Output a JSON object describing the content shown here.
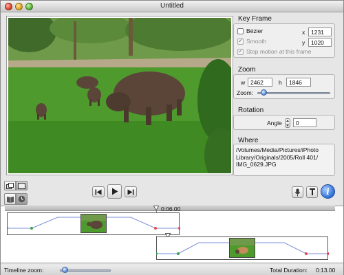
{
  "window": {
    "title": "Untitled"
  },
  "key_frame": {
    "section_title": "Key Frame",
    "bezier_label": "Bézier",
    "smooth_label": "Smooth",
    "stop_motion_label": "Stop motion at this frame",
    "x_label": "x",
    "x_value": "1231",
    "y_label": "y",
    "y_value": "1020"
  },
  "zoom": {
    "section_title": "Zoom",
    "w_label": "w",
    "w_value": "2462",
    "h_label": "h",
    "h_value": "1846",
    "zoom_label": "Zoom:",
    "zoom_level": 0.05
  },
  "rotation": {
    "section_title": "Rotation",
    "angle_label": "Angle",
    "angle_value": "0"
  },
  "where": {
    "section_title": "Where",
    "path": "/Volumes/Media/Pictures/iPhoto Library/Originals/2005/Roll 401/ IMG_0629.JPG"
  },
  "timeline": {
    "playhead_time": "0:06.00",
    "zoom_label": "Timeline zoom:",
    "zoom_level": 0.05,
    "total_duration_label": "Total Duration:",
    "total_duration_value": "0:13.00"
  },
  "icons": {
    "view_toggle_1": "overlapping-windows-icon",
    "view_toggle_2": "single-window-icon",
    "storyboard": "book-icon",
    "clock": "clock-icon",
    "rewind": "skip-back-icon",
    "play": "play-icon",
    "forward": "skip-forward-icon",
    "voice": "microphone-icon",
    "text": "text-icon",
    "info": "info-icon"
  },
  "colors": {
    "accent": "#2f6fd4",
    "curve_line": "#7a8fd8",
    "keyframe_red": "#e04a4a",
    "keyframe_green": "#37a24a"
  }
}
